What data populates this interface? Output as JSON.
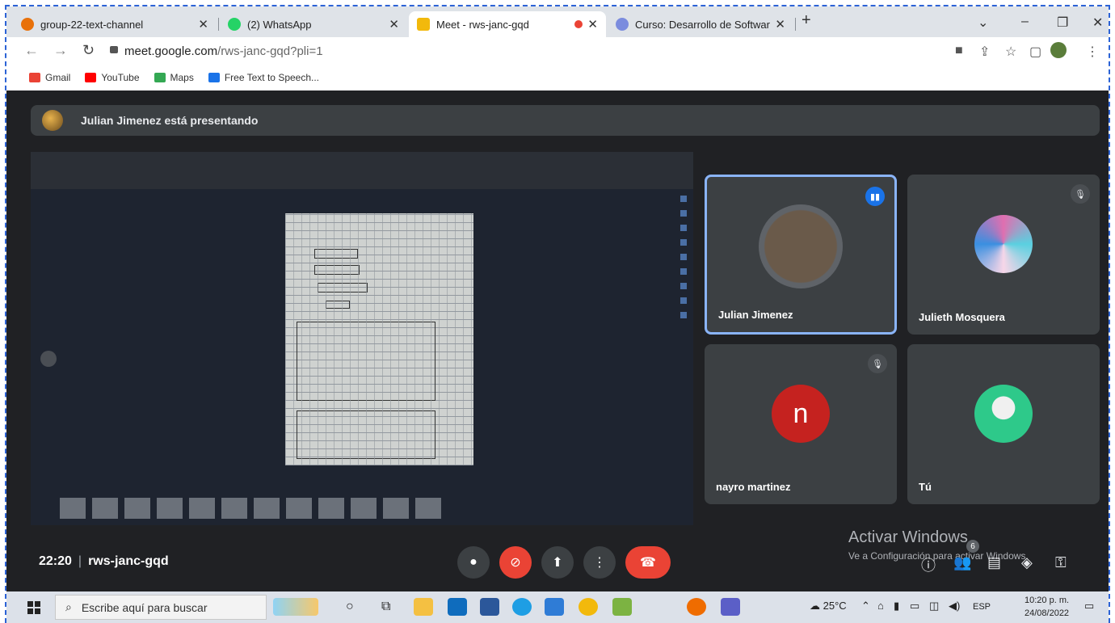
{
  "browser": {
    "tabs": [
      {
        "title": "group-22-text-channel",
        "color": "#e8710a"
      },
      {
        "title": "(2) WhatsApp",
        "color": "#25d366"
      },
      {
        "title": "Meet - rws-janc-gqd",
        "color": "#f2b90c"
      },
      {
        "title": "Curso: Desarrollo de Software - (",
        "color": "#7b8cde"
      }
    ],
    "new_tab": "+",
    "url_host": "meet.google.com",
    "url_path": "/rws-janc-gqd?pli=1",
    "bookmarks": [
      {
        "label": "Gmail",
        "color": "#ea4335"
      },
      {
        "label": "YouTube",
        "color": "#ff0000"
      },
      {
        "label": "Maps",
        "color": "#34a853"
      },
      {
        "label": "Free Text to Speech...",
        "color": "#1a73e8"
      }
    ]
  },
  "meet": {
    "presenting": "Julian Jimenez está presentando",
    "participants": [
      {
        "name": "Julian Jimenez",
        "speaking": true
      },
      {
        "name": "Julieth Mosquera",
        "muted": true
      },
      {
        "name": "nayro martinez",
        "muted": true,
        "initial": "n"
      },
      {
        "name": "Tú"
      }
    ],
    "time": "22:20",
    "code": "rws-janc-gqd",
    "people_count": "6"
  },
  "watermark": {
    "line1": "Activar Windows",
    "line2": "Ve a Configuración para activar Windows."
  },
  "taskbar": {
    "search_placeholder": "Escribe aquí para buscar",
    "weather": "25°C",
    "lang": "ESP",
    "time": "10:20 p. m.",
    "date": "24/08/2022"
  }
}
